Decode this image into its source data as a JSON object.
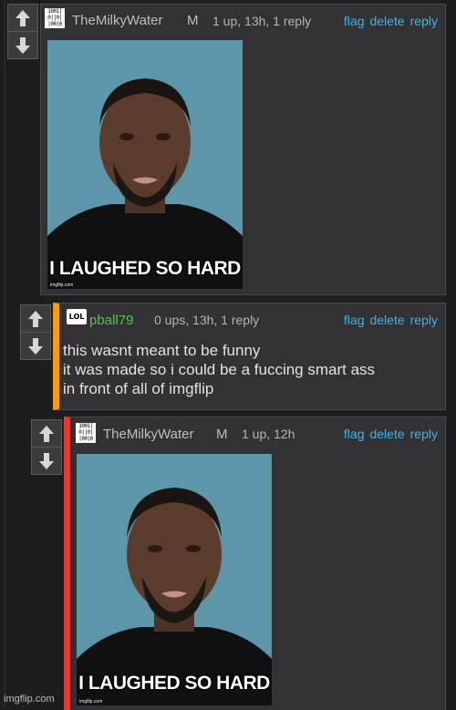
{
  "comments": [
    {
      "username": "TheMilkyWater",
      "badge": "M",
      "meta": "1 up, 13h, 1 reply",
      "actions": [
        "flag",
        "delete",
        "reply"
      ],
      "avatar_lines": [
        "1001|",
        "0||0|",
        "|00|0"
      ],
      "meme": {
        "caption": "I LAUGHED SO HARD",
        "watermark": "imgflip.com"
      }
    },
    {
      "username": "pball79",
      "meta": "0 ups, 13h, 1 reply",
      "actions": [
        "flag",
        "delete",
        "reply"
      ],
      "avatar_text": "LOL",
      "text": "this wasnt meant to be funny\nit was made so i could be a fuccing smart ass\nin front of all of imgflip"
    },
    {
      "username": "TheMilkyWater",
      "badge": "M",
      "meta": "1 up, 12h",
      "actions": [
        "flag",
        "delete",
        "reply"
      ],
      "avatar_lines": [
        "1001|",
        "0||0|",
        "|00|0"
      ],
      "meme": {
        "caption": "I LAUGHED SO HARD",
        "watermark": "imgflip.com"
      }
    }
  ],
  "footer": {
    "watermark": "imgflip.com"
  },
  "colors": {
    "accent_link": "#3fb2ea",
    "reply_border_1": "#f39c12",
    "reply_border_2": "#e53935",
    "username_green": "#5cc04a"
  },
  "icons": [
    "upvote-arrow-icon",
    "downvote-arrow-icon"
  ]
}
